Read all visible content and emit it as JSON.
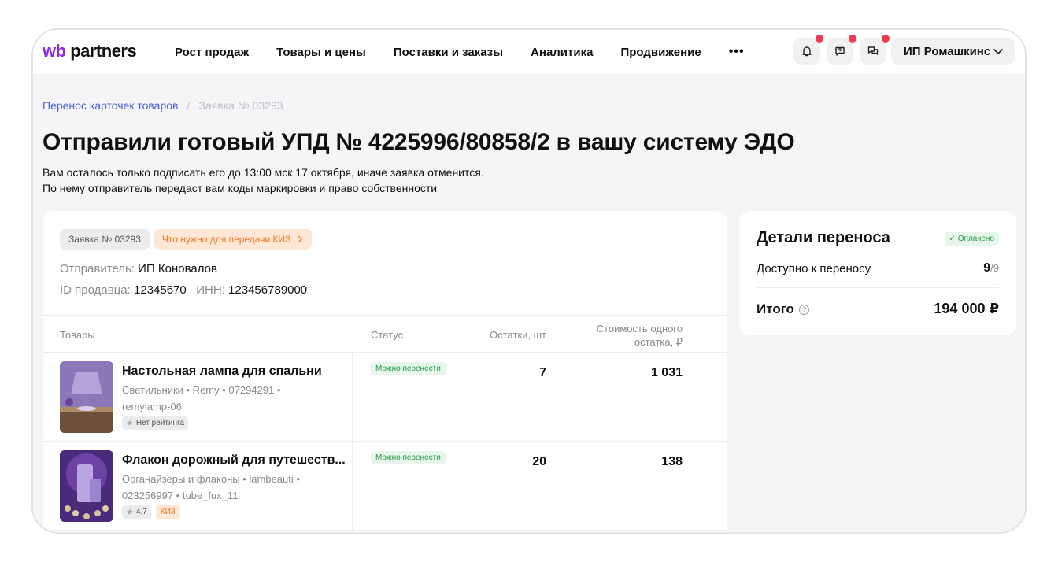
{
  "header": {
    "logo_wb": "wb",
    "logo_text": "partners",
    "nav": [
      "Рост продаж",
      "Товары и цены",
      "Поставки и заказы",
      "Аналитика",
      "Продвижение"
    ],
    "more": "•••",
    "account": "ИП Ромашкинс",
    "icons": [
      "bell-icon",
      "support-icon",
      "chat-icon"
    ],
    "notification_color": "#f0394d"
  },
  "breadcrumb": {
    "link": "Перенос карточек товаров",
    "separator": "/",
    "current": "Заявка № 03293"
  },
  "page": {
    "title": "Отправили готовый УПД № 4225996/80858/2 в вашу систему ЭДО",
    "subtitle_line1": "Вам осталось только подписать его до 13:00 мск 17 октября, иначе заявка отменится.",
    "subtitle_line2": "По нему отправитель передаст вам коды маркировки и право собственности"
  },
  "request": {
    "number_chip": "Заявка № 03293",
    "kiz_chip": "Что нужно для передачи КИЗ",
    "sender_label": "Отправитель:",
    "sender": "ИП Коновалов",
    "seller_id_label": "ID продавца:",
    "seller_id": "12345670",
    "inn_label": "ИНН:",
    "inn": "123456789000"
  },
  "table": {
    "columns": {
      "goods": "Товары",
      "status": "Статус",
      "stock": "Остатки, шт",
      "cost_line1": "Стоимость одного",
      "cost_line2": "остатка, ₽"
    },
    "rows": [
      {
        "name": "Настольная лампа для спальни",
        "meta_line1": "Светильники • Remy • 07294291 •",
        "meta_line2": "remylamp-06",
        "rating": "Нет рейтинга",
        "badge": "",
        "status": "Можно перенести",
        "stock": "7",
        "cost": "1 031"
      },
      {
        "name": "Флакон дорожный для путешеств...",
        "meta_line1": "Органайзеры и флаконы • lambeauti •",
        "meta_line2": "023256997 • tube_fux_11",
        "rating": "4.7",
        "badge": "КИЗ",
        "status": "Можно перенести",
        "stock": "20",
        "cost": "138"
      }
    ]
  },
  "details": {
    "title": "Детали переноса",
    "paid": "✓ Оплачено",
    "available_label": "Доступно к переносу",
    "available": "9",
    "available_total": "/9",
    "total_label": "Итого",
    "total": "194 000 ₽"
  },
  "colors": {
    "accent": "#8b2be2",
    "link": "#4a63d6",
    "success": "#2a9a4a",
    "warning": "#f07a2a"
  }
}
